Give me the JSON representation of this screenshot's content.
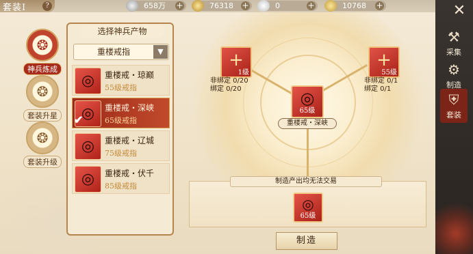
{
  "header": {
    "title": "套装I",
    "resources": [
      {
        "icon": "silver-coin-icon",
        "value": "658万"
      },
      {
        "icon": "gold-ingot-icon",
        "value": "76318"
      },
      {
        "icon": "jade-icon",
        "value": "0"
      },
      {
        "icon": "gold-bar-icon",
        "value": "10768"
      }
    ]
  },
  "left_tabs": [
    {
      "label": "神兵炼成",
      "active": true
    },
    {
      "label": "套装升星",
      "active": false
    },
    {
      "label": "套装升级",
      "active": false
    }
  ],
  "list_panel": {
    "title": "选择神兵产物",
    "dropdown_value": "重楼戒指",
    "items": [
      {
        "name": "重楼戒・琼巅",
        "level": "55级戒指",
        "selected": false
      },
      {
        "name": "重楼戒・深峡",
        "level": "65级戒指",
        "selected": true
      },
      {
        "name": "重楼戒・辽城",
        "level": "75级戒指",
        "selected": false
      },
      {
        "name": "重楼戒・伏千",
        "level": "85级戒指",
        "selected": false
      }
    ]
  },
  "materials": [
    {
      "level": "1级",
      "lines": [
        "非绑定 0/20",
        "绑定 0/20"
      ]
    },
    {
      "level": "55级",
      "lines": [
        "非绑定 0/1",
        "绑定 0/1"
      ]
    }
  ],
  "center": {
    "name": "重楼戒・深峡",
    "level": "65级"
  },
  "result": {
    "note": "制造产出均无法交易",
    "level": "65级"
  },
  "craft_button": "制造",
  "right_tabs": [
    {
      "label": "采集",
      "icon": "pickaxe-icon",
      "active": false
    },
    {
      "label": "制造",
      "icon": "anvil-icon",
      "active": false
    },
    {
      "label": "套装",
      "icon": "armor-icon",
      "active": true
    }
  ],
  "colors": {
    "accent_red": "#a72c1b",
    "gold": "#d9b26b",
    "panel": "#f5ead3"
  }
}
